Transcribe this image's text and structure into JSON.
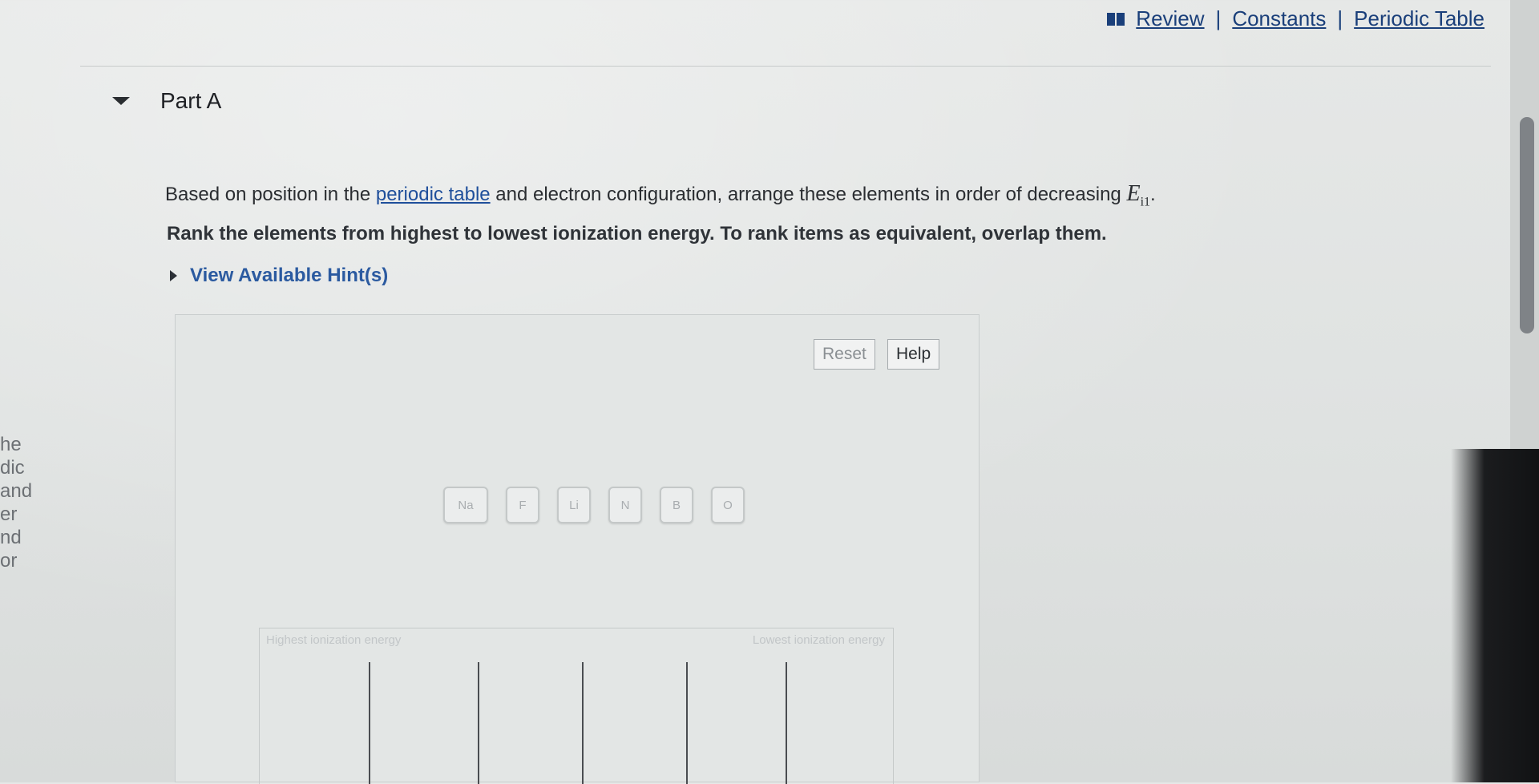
{
  "top_links": {
    "review": "Review",
    "constants": "Constants",
    "periodic_table": "Periodic Table",
    "separator": "|"
  },
  "part": {
    "title": "Part A"
  },
  "question": {
    "before_link": "Based on position in the ",
    "link_text": "periodic table",
    "after_link": " and electron configuration, arrange these elements in order of decreasing ",
    "symbol_main": "E",
    "symbol_sub": "i1",
    "end": "."
  },
  "instruction": "Rank the elements from highest to lowest ionization energy. To rank items as equivalent, overlap them.",
  "hints": {
    "label": "View Available Hint(s)"
  },
  "buttons": {
    "reset": "Reset",
    "help": "Help"
  },
  "elements": [
    "Na",
    "F",
    "Li",
    "N",
    "B",
    "O"
  ],
  "rank_area": {
    "left_label": "Highest ionization energy",
    "right_label": "Lowest ionization energy"
  },
  "left_cut_text": [
    "he",
    "dic",
    "and",
    "er",
    "nd",
    "or"
  ]
}
